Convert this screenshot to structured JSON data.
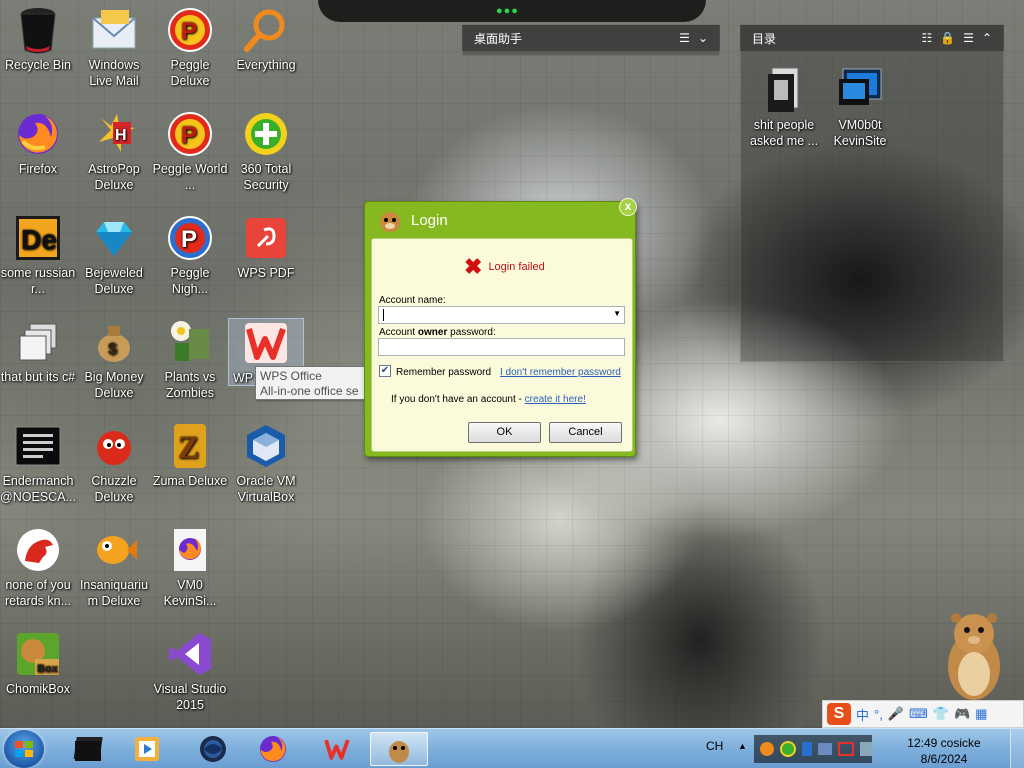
{
  "desktop": {
    "icons": [
      {
        "label": "Recycle Bin",
        "icon": "recycle-bin-icon"
      },
      {
        "label": "Windows Live Mail",
        "icon": "mail-icon"
      },
      {
        "label": "Peggle Deluxe",
        "icon": "peggle-icon"
      },
      {
        "label": "Everything",
        "icon": "search-magnifier-icon"
      },
      {
        "label": "Firefox",
        "icon": "firefox-icon"
      },
      {
        "label": "AstroPop Deluxe",
        "icon": "astropop-icon"
      },
      {
        "label": "Peggle World ...",
        "icon": "peggle-icon"
      },
      {
        "label": "360 Total Security",
        "icon": "shield-plus-icon"
      },
      {
        "label": "some russian r...",
        "icon": "de-app-icon"
      },
      {
        "label": "Bejeweled Deluxe",
        "icon": "gem-icon"
      },
      {
        "label": "Peggle Nigh...",
        "icon": "peggle-icon"
      },
      {
        "label": "WPS PDF",
        "icon": "pdf-icon"
      },
      {
        "label": "that but its c#",
        "icon": "windows-stack-icon"
      },
      {
        "label": "Big Money Deluxe",
        "icon": "money-bag-icon"
      },
      {
        "label": "Plants vs Zombies",
        "icon": "plant-icon"
      },
      {
        "label": "WPS Office",
        "icon": "wps-office-icon"
      },
      {
        "label": "Endermanch @NOESCA...",
        "icon": "terminal-icon"
      },
      {
        "label": "Chuzzle Deluxe",
        "icon": "chuzzle-icon"
      },
      {
        "label": "Zuma Deluxe",
        "icon": "zuma-icon"
      },
      {
        "label": "Oracle VM VirtualBox",
        "icon": "virtualbox-icon"
      },
      {
        "label": "none of you retards kn...",
        "icon": "dinosaur-icon"
      },
      {
        "label": "Insaniquarium Deluxe",
        "icon": "fish-icon"
      },
      {
        "label": "VM0 KevinSi...",
        "icon": "firefox-file-icon"
      },
      {
        "label": "ChomikBox",
        "icon": "hamster-box-icon"
      },
      {
        "label": "Visual Studio 2015",
        "icon": "visual-studio-icon"
      },
      {
        "label": "shit people asked me ...",
        "icon": "folder-icon"
      },
      {
        "label": "VM0b0t KevinSite",
        "icon": "monitor-icon"
      }
    ],
    "wps_partial_label": "WP"
  },
  "gadgets": {
    "left_title": "桌面助手",
    "right_title": "目录"
  },
  "dialog": {
    "title": "Login",
    "close_symbol": "x",
    "error_text": "Login failed",
    "account_label": "Account name:",
    "account_value": "",
    "password_label_prefix": "Account ",
    "password_label_bold": "owner",
    "password_label_suffix": " password:",
    "password_value": "",
    "remember_label": "Remember password",
    "remember_checked": true,
    "forgot_link": "I don't remember password",
    "signup_text": "If you don't have an account - ",
    "signup_link": "create it here!",
    "ok_label": "OK",
    "cancel_label": "Cancel"
  },
  "tooltip": {
    "title": "WPS Office",
    "desc": "All-in-one office se"
  },
  "ime_bar": {
    "logo": "S",
    "items": [
      "中",
      "°,",
      "🎤",
      "⌨",
      "👕",
      "🎮",
      "▦"
    ]
  },
  "taskbar": {
    "items": [
      "cmd-window",
      "media-player",
      "globe-app",
      "firefox",
      "wps-office",
      "chomikbox"
    ],
    "language": "CH",
    "time": "12:49 cosicke",
    "date": "8/6/2024"
  },
  "colors": {
    "dialog_green": "#86b820",
    "dialog_body": "#fbfbdc",
    "error_red": "#c0101a",
    "link_blue": "#2a60b8",
    "taskbar_blue": "#7fb0dc"
  }
}
